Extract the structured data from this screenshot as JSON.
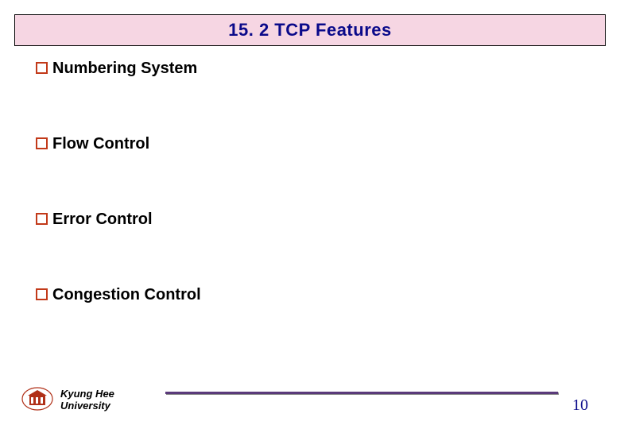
{
  "title": "15. 2 TCP Features",
  "bullets": [
    "Numbering System",
    "Flow Control",
    "Error Control",
    "Congestion Control"
  ],
  "footer": {
    "institution_line1": "Kyung Hee",
    "institution_line2": "University",
    "page_number": "10"
  }
}
